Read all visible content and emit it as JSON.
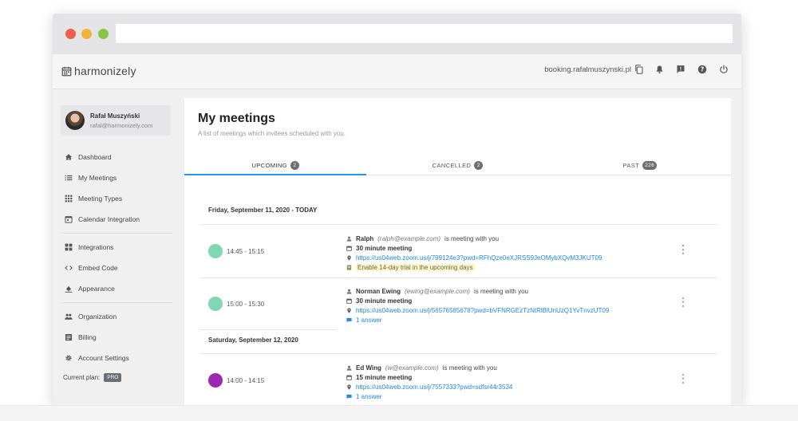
{
  "app": {
    "logo_text": "harmonizely",
    "booking_url": "booking.rafalmuszynski.pl"
  },
  "user": {
    "name": "Rafał Muszyński",
    "email": "rafal@harmonizely.com"
  },
  "sidebar": {
    "items": [
      {
        "label": "Dashboard",
        "icon": "home-icon"
      },
      {
        "label": "My Meetings",
        "icon": "list-icon"
      },
      {
        "label": "Meeting Types",
        "icon": "grid-icon"
      },
      {
        "label": "Calendar Integration",
        "icon": "calendar-icon"
      },
      {
        "label": "Integrations",
        "icon": "widgets-icon"
      },
      {
        "label": "Embed Code",
        "icon": "code-icon"
      },
      {
        "label": "Appearance",
        "icon": "paint-icon"
      },
      {
        "label": "Organization",
        "icon": "people-icon"
      },
      {
        "label": "Billing",
        "icon": "billing-icon"
      },
      {
        "label": "Account Settings",
        "icon": "gear-icon"
      }
    ],
    "plan_label": "Current plan:",
    "plan_badge": "PRO"
  },
  "page": {
    "title": "My meetings",
    "subtitle": "A list of meetings which invitees scheduled with you."
  },
  "tabs": [
    {
      "label": "UPCOMING",
      "count": "2"
    },
    {
      "label": "CANCELLED",
      "count": "2"
    },
    {
      "label": "PAST",
      "count": "226"
    }
  ],
  "days": [
    {
      "header": "Friday, September 11, 2020 - TODAY",
      "meetings": [
        {
          "time": "14:45 - 15:15",
          "color": "#7fd8b3",
          "invitee_name": "Ralph",
          "invitee_email": "(ralph@example.com)",
          "meeting_text": "is meeting with you",
          "type": "30 minute meeting",
          "link": "https://us04web.zoom.us/j/799124e3?pwd=RFhQze0eXJRSS9JeOMybXQvM3JKUT09",
          "extra": "Enable 14-day trial in the upcoming days"
        },
        {
          "time": "15:00 - 15:30",
          "color": "#7fd8b3",
          "invitee_name": "Norman Ewing",
          "invitee_email": "(ewing@example.com)",
          "meeting_text": "is meeting with you",
          "type": "30 minute meeting",
          "link": "https://us04web.zoom.us/j/56576585678?pwd=bVFNRGEzTzNtRlBlUnUzQ1YvTnvzUT09",
          "extra": "1 answer"
        }
      ]
    },
    {
      "header": "Saturday, September 12, 2020",
      "meetings": [
        {
          "time": "14:00 - 14:15",
          "color": "#9c27b0",
          "invitee_name": "Ed Wing",
          "invitee_email": "(w@example.com)",
          "meeting_text": "is meeting with you",
          "type": "15 minute meeting",
          "link": "https://us04web.zoom.us/j/7557333?pwd=sdfsr44r3534",
          "extra": "1 answer"
        }
      ]
    }
  ],
  "colors": {
    "accent": "#2196f3",
    "link": "#1e88e5",
    "teal_dot": "#7fd8b3",
    "purple_dot": "#9c27b0"
  }
}
